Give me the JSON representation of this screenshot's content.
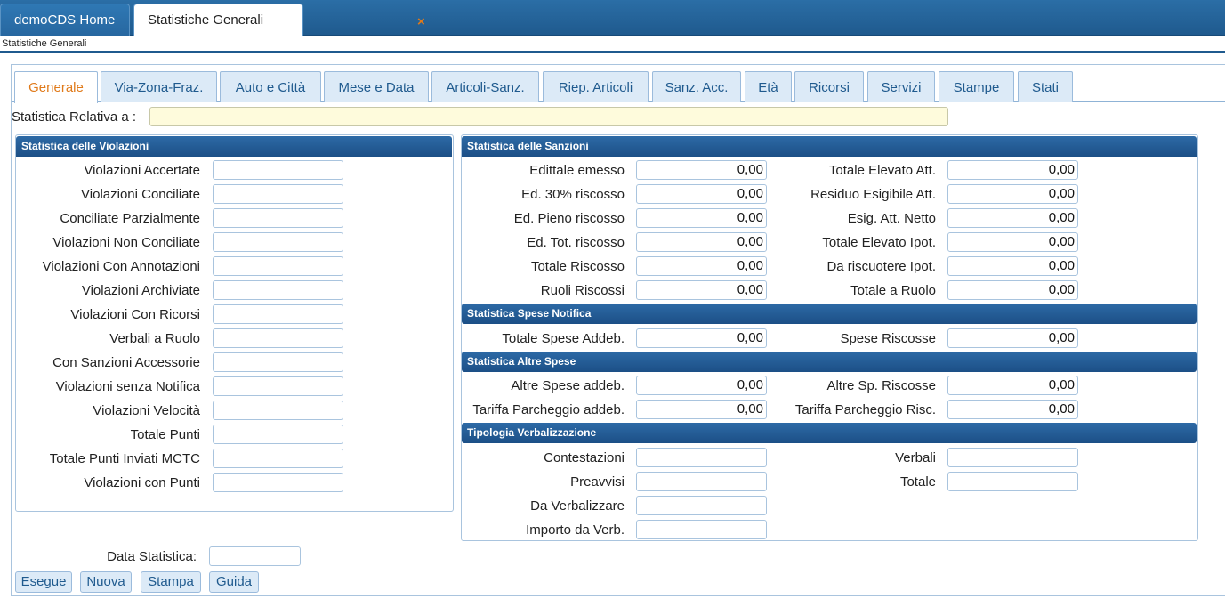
{
  "window_tabs": [
    {
      "label": "demoCDS Home"
    },
    {
      "label": "Statistiche Generali",
      "close": "×"
    }
  ],
  "breadcrumb": "Statistiche Generali",
  "tabs": [
    "Generale",
    "Via-Zona-Fraz.",
    "Auto e Città",
    "Mese e Data",
    "Articoli-Sanz.",
    "Riep. Articoli",
    "Sanz. Acc.",
    "Età",
    "Ricorsi",
    "Servizi",
    "Stampe",
    "Stati"
  ],
  "active_tab": "Generale",
  "relativa": {
    "label": "Statistica Relativa a :",
    "value": ""
  },
  "violazioni": {
    "title": "Statistica delle Violazioni",
    "rows": [
      {
        "label": "Violazioni Accertate",
        "value": ""
      },
      {
        "label": "Violazioni Conciliate",
        "value": ""
      },
      {
        "label": "Conciliate Parzialmente",
        "value": ""
      },
      {
        "label": "Violazioni Non Conciliate",
        "value": ""
      },
      {
        "label": "Violazioni Con Annotazioni",
        "value": ""
      },
      {
        "label": "Violazioni Archiviate",
        "value": ""
      },
      {
        "label": "Violazioni Con Ricorsi",
        "value": ""
      },
      {
        "label": "Verbali a Ruolo",
        "value": ""
      },
      {
        "label": "Con Sanzioni Accessorie",
        "value": ""
      },
      {
        "label": "Violazioni senza Notifica",
        "value": ""
      },
      {
        "label": "Violazioni Velocità",
        "value": ""
      },
      {
        "label": "Totale Punti",
        "value": ""
      },
      {
        "label": "Totale Punti Inviati MCTC",
        "value": ""
      },
      {
        "label": "Violazioni con Punti",
        "value": ""
      }
    ]
  },
  "sanzioni": {
    "title": "Statistica delle Sanzioni",
    "left": [
      {
        "label": "Edittale emesso",
        "value": "0,00"
      },
      {
        "label": "Ed. 30% riscosso",
        "value": "0,00"
      },
      {
        "label": "Ed. Pieno riscosso",
        "value": "0,00"
      },
      {
        "label": "Ed. Tot. riscosso",
        "value": "0,00"
      },
      {
        "label": "Totale Riscosso",
        "value": "0,00"
      },
      {
        "label": "Ruoli Riscossi",
        "value": "0,00"
      }
    ],
    "right": [
      {
        "label": "Totale Elevato Att.",
        "value": "0,00"
      },
      {
        "label": "Residuo Esigibile Att.",
        "value": "0,00"
      },
      {
        "label": "Esig. Att. Netto",
        "value": "0,00"
      },
      {
        "label": "Totale Elevato Ipot.",
        "value": "0,00"
      },
      {
        "label": "Da riscuotere Ipot.",
        "value": "0,00"
      },
      {
        "label": "Totale a Ruolo",
        "value": "0,00"
      }
    ]
  },
  "spese_notifica": {
    "title": "Statistica Spese Notifica",
    "left": [
      {
        "label": "Totale Spese Addeb.",
        "value": "0,00"
      }
    ],
    "right": [
      {
        "label": "Spese Riscosse",
        "value": "0,00"
      }
    ]
  },
  "altre_spese": {
    "title": "Statistica Altre Spese",
    "left": [
      {
        "label": "Altre Spese addeb.",
        "value": "0,00"
      },
      {
        "label": "Tariffa Parcheggio addeb.",
        "value": "0,00"
      }
    ],
    "right": [
      {
        "label": "Altre Sp. Riscosse",
        "value": "0,00"
      },
      {
        "label": "Tariffa Parcheggio Risc.",
        "value": "0,00"
      }
    ]
  },
  "tipologia": {
    "title": "Tipologia Verbalizzazione",
    "left": [
      {
        "label": "Contestazioni",
        "value": ""
      },
      {
        "label": "Preavvisi",
        "value": ""
      },
      {
        "label": "Da Verbalizzare",
        "value": ""
      },
      {
        "label": "Importo da Verb.",
        "value": ""
      }
    ],
    "right": [
      {
        "label": "Verbali",
        "value": ""
      },
      {
        "label": "Totale",
        "value": ""
      }
    ]
  },
  "data_statistica": {
    "label": "Data Statistica:",
    "value": ""
  },
  "buttons": [
    "Esegue",
    "Nuova",
    "Stampa",
    "Guida"
  ],
  "colors": {
    "header_blue": "#1f5a8e",
    "active_tab_orange": "#e07a1a",
    "highlight_input": "#fefbdc"
  }
}
